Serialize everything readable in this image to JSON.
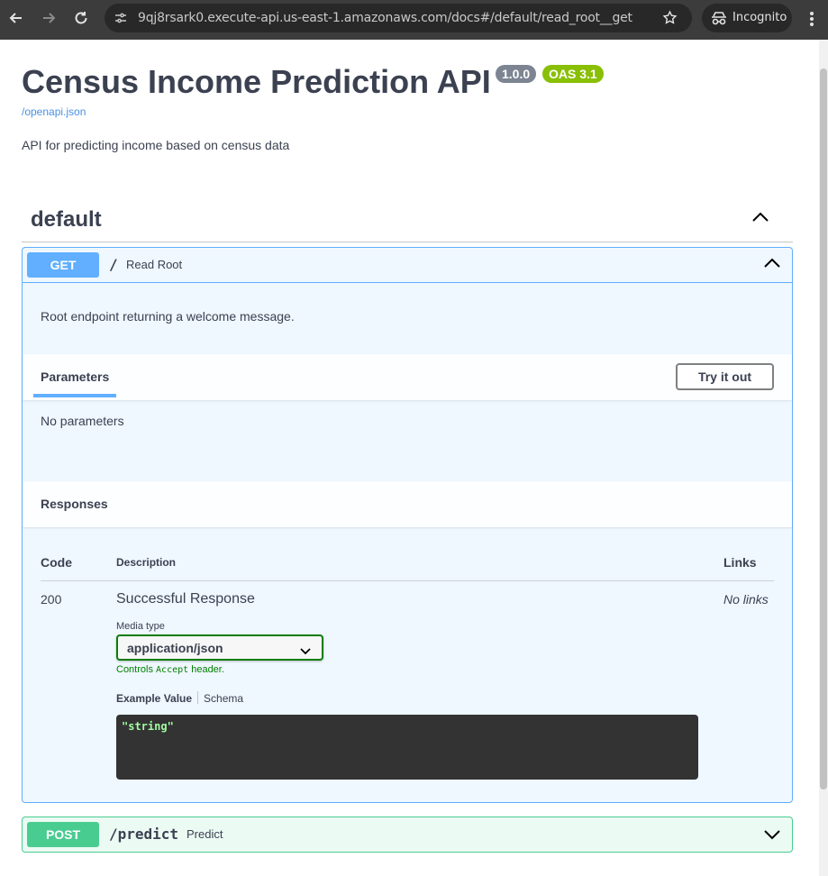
{
  "browser": {
    "url": "9qj8rsark0.execute-api.us-east-1.amazonaws.com/docs#/default/read_root__get",
    "incognito_label": "Incognito"
  },
  "info": {
    "title": "Census Income Prediction API",
    "version": "1.0.0",
    "oas": "OAS 3.1",
    "spec_link": "/openapi.json",
    "description": "API for predicting income based on census data"
  },
  "tag": {
    "name": "default"
  },
  "operations": [
    {
      "method": "GET",
      "path": "/",
      "summary": "Read Root",
      "description": "Root endpoint returning a welcome message.",
      "parameters_title": "Parameters",
      "try_label": "Try it out",
      "no_params": "No parameters",
      "responses_title": "Responses",
      "responses_header": {
        "code": "Code",
        "description": "Description",
        "links": "Links"
      },
      "response": {
        "code": "200",
        "description": "Successful Response",
        "links": "No links",
        "media_type_label": "Media type",
        "media_type": "application/json",
        "controls_prefix": "Controls ",
        "controls_code": "Accept",
        "controls_suffix": " header.",
        "example_tab": "Example Value",
        "schema_tab": "Schema",
        "example": "\"string\""
      }
    },
    {
      "method": "POST",
      "path": "/predict",
      "summary": "Predict"
    }
  ],
  "colors": {
    "get": "#61affe",
    "post": "#49cc90",
    "version_badge": "#7d8492",
    "oas_badge": "#89bf04"
  }
}
